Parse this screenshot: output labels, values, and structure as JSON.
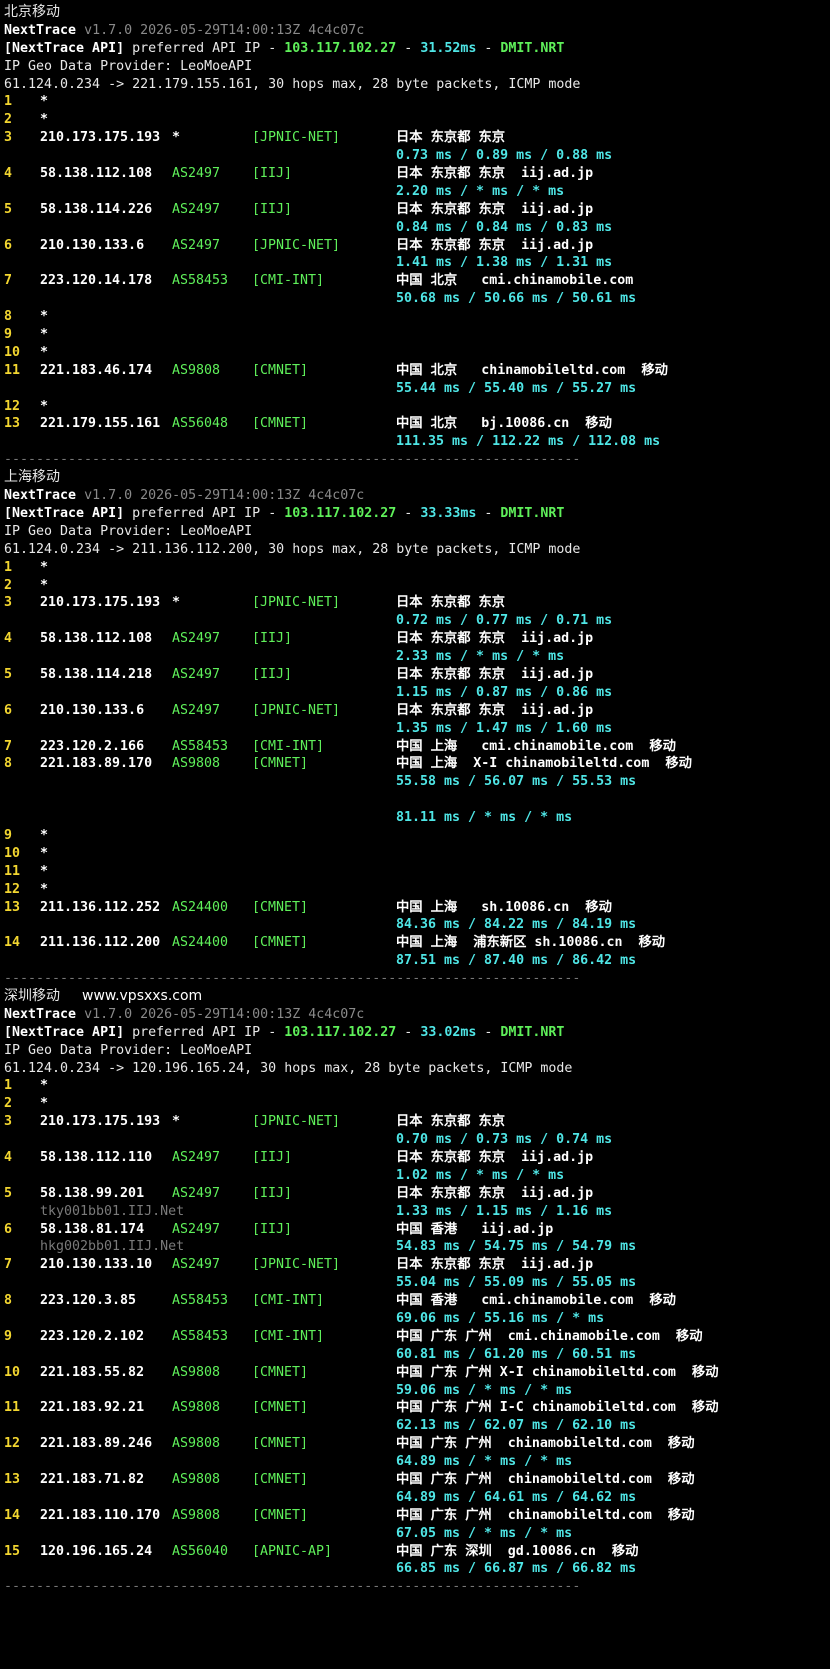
{
  "colors": {
    "background": "#000000",
    "hop_number": "#f3d630",
    "asn_tag": "#5ff05a",
    "latency": "#4fe6e6",
    "version_meta": "#8a8a8a"
  },
  "watermark": "www.vpsxxs.com",
  "traces": [
    {
      "title": "北京移动",
      "app_name": "NextTrace",
      "version": "v1.7.0 2026-05-29T14:00:13Z 4c4c07c",
      "api_prefix": "[NextTrace API]",
      "api_mid": "preferred API IP",
      "api_ip": "103.117.102.27",
      "api_latency": "31.52ms",
      "api_node": "DMIT.NRT",
      "geo_provider": "IP Geo Data Provider: LeoMoeAPI",
      "target_line": "61.124.0.234 -> 221.179.155.161, 30 hops max, 28 byte packets, ICMP mode",
      "hops": [
        {
          "n": "1",
          "ip": "*"
        },
        {
          "n": "2",
          "ip": "*"
        },
        {
          "n": "3",
          "ip": "210.173.175.193",
          "as": "*",
          "tag": "[JPNIC-NET]",
          "geo": "日本 东京都 东京",
          "rtt": "0.73 ms / 0.89 ms / 0.88 ms"
        },
        {
          "n": "4",
          "ip": "58.138.112.108",
          "as": "AS2497",
          "tag": "[IIJ]",
          "geo": "日本 东京都 东京  iij.ad.jp",
          "rtt": "2.20 ms / * ms / * ms"
        },
        {
          "n": "5",
          "ip": "58.138.114.226",
          "as": "AS2497",
          "tag": "[IIJ]",
          "geo": "日本 东京都 东京  iij.ad.jp",
          "rtt": "0.84 ms / 0.84 ms / 0.83 ms"
        },
        {
          "n": "6",
          "ip": "210.130.133.6",
          "as": "AS2497",
          "tag": "[JPNIC-NET]",
          "geo": "日本 东京都 东京  iij.ad.jp",
          "rtt": "1.41 ms / 1.38 ms / 1.31 ms"
        },
        {
          "n": "7",
          "ip": "223.120.14.178",
          "as": "AS58453",
          "tag": "[CMI-INT]",
          "geo": "中国 北京   cmi.chinamobile.com",
          "rtt": "50.68 ms / 50.66 ms / 50.61 ms"
        },
        {
          "n": "8",
          "ip": "*"
        },
        {
          "n": "9",
          "ip": "*"
        },
        {
          "n": "10",
          "ip": "*"
        },
        {
          "n": "11",
          "ip": "221.183.46.174",
          "as": "AS9808",
          "tag": "[CMNET]",
          "geo": "中国 北京   chinamobileltd.com  移动",
          "rtt": "55.44 ms / 55.40 ms / 55.27 ms"
        },
        {
          "n": "12",
          "ip": "*"
        },
        {
          "n": "13",
          "ip": "221.179.155.161",
          "as": "AS56048",
          "tag": "[CMNET]",
          "geo": "中国 北京   bj.10086.cn  移动",
          "rtt": "111.35 ms / 112.22 ms / 112.08 ms"
        }
      ]
    },
    {
      "title": "上海移动",
      "app_name": "NextTrace",
      "version": "v1.7.0 2026-05-29T14:00:13Z 4c4c07c",
      "api_prefix": "[NextTrace API]",
      "api_mid": "preferred API IP",
      "api_ip": "103.117.102.27",
      "api_latency": "33.33ms",
      "api_node": "DMIT.NRT",
      "geo_provider": "IP Geo Data Provider: LeoMoeAPI",
      "target_line": "61.124.0.234 -> 211.136.112.200, 30 hops max, 28 byte packets, ICMP mode",
      "hops": [
        {
          "n": "1",
          "ip": "*"
        },
        {
          "n": "2",
          "ip": "*"
        },
        {
          "n": "3",
          "ip": "210.173.175.193",
          "as": "*",
          "tag": "[JPNIC-NET]",
          "geo": "日本 东京都 东京",
          "rtt": "0.72 ms / 0.77 ms / 0.71 ms"
        },
        {
          "n": "4",
          "ip": "58.138.112.108",
          "as": "AS2497",
          "tag": "[IIJ]",
          "geo": "日本 东京都 东京  iij.ad.jp",
          "rtt": "2.33 ms / * ms / * ms"
        },
        {
          "n": "5",
          "ip": "58.138.114.218",
          "as": "AS2497",
          "tag": "[IIJ]",
          "geo": "日本 东京都 东京  iij.ad.jp",
          "rtt": "1.15 ms / 0.87 ms / 0.86 ms"
        },
        {
          "n": "6",
          "ip": "210.130.133.6",
          "as": "AS2497",
          "tag": "[JPNIC-NET]",
          "geo": "日本 东京都 东京  iij.ad.jp",
          "rtt": "1.35 ms / 1.47 ms / 1.60 ms"
        },
        {
          "n": "7",
          "ip": "223.120.2.166",
          "as": "AS58453",
          "tag": "[CMI-INT]",
          "geo": "中国 上海   cmi.chinamobile.com  移动"
        },
        {
          "n": "8",
          "ip": "221.183.89.170",
          "as": "AS9808",
          "tag": "[CMNET]",
          "geo": "中国 上海  X-I chinamobileltd.com  移动",
          "rtt": "55.58 ms / 56.07 ms / 55.53 ms"
        },
        {
          "n": "",
          "ip": "",
          "rtt": "81.11 ms / * ms / * ms"
        },
        {
          "n": "9",
          "ip": "*"
        },
        {
          "n": "10",
          "ip": "*"
        },
        {
          "n": "11",
          "ip": "*"
        },
        {
          "n": "12",
          "ip": "*"
        },
        {
          "n": "13",
          "ip": "211.136.112.252",
          "as": "AS24400",
          "tag": "[CMNET]",
          "geo": "中国 上海   sh.10086.cn  移动",
          "rtt": "84.36 ms / 84.22 ms / 84.19 ms"
        },
        {
          "n": "14",
          "ip": "211.136.112.200",
          "as": "AS24400",
          "tag": "[CMNET]",
          "geo": "中国 上海  浦东新区 sh.10086.cn  移动",
          "rtt": "87.51 ms / 87.40 ms / 86.42 ms"
        }
      ]
    },
    {
      "title": "深圳移动",
      "app_name": "NextTrace",
      "version": "v1.7.0 2026-05-29T14:00:13Z 4c4c07c",
      "api_prefix": "[NextTrace API]",
      "api_mid": "preferred API IP",
      "api_ip": "103.117.102.27",
      "api_latency": "33.02ms",
      "api_node": "DMIT.NRT",
      "geo_provider": "IP Geo Data Provider: LeoMoeAPI",
      "target_line": "61.124.0.234 -> 120.196.165.24, 30 hops max, 28 byte packets, ICMP mode",
      "hops": [
        {
          "n": "1",
          "ip": "*"
        },
        {
          "n": "2",
          "ip": "*"
        },
        {
          "n": "3",
          "ip": "210.173.175.193",
          "as": "*",
          "tag": "[JPNIC-NET]",
          "geo": "日本 东京都 东京",
          "rtt": "0.70 ms / 0.73 ms / 0.74 ms"
        },
        {
          "n": "4",
          "ip": "58.138.112.110",
          "as": "AS2497",
          "tag": "[IIJ]",
          "geo": "日本 东京都 东京  iij.ad.jp",
          "rtt": "1.02 ms / * ms / * ms"
        },
        {
          "n": "5",
          "ip": "58.138.99.201",
          "as": "AS2497",
          "tag": "[IIJ]",
          "geo": "日本 东京都 东京  iij.ad.jp",
          "host": "tky001bb01.IIJ.Net",
          "rtt": "1.33 ms / 1.15 ms / 1.16 ms"
        },
        {
          "n": "6",
          "ip": "58.138.81.174",
          "as": "AS2497",
          "tag": "[IIJ]",
          "geo": "中国 香港   iij.ad.jp",
          "host": "hkg002bb01.IIJ.Net",
          "rtt": "54.83 ms / 54.75 ms / 54.79 ms"
        },
        {
          "n": "7",
          "ip": "210.130.133.10",
          "as": "AS2497",
          "tag": "[JPNIC-NET]",
          "geo": "日本 东京都 东京  iij.ad.jp",
          "rtt": "55.04 ms / 55.09 ms / 55.05 ms"
        },
        {
          "n": "8",
          "ip": "223.120.3.85",
          "as": "AS58453",
          "tag": "[CMI-INT]",
          "geo": "中国 香港   cmi.chinamobile.com  移动",
          "rtt": "69.06 ms / 55.16 ms / * ms"
        },
        {
          "n": "9",
          "ip": "223.120.2.102",
          "as": "AS58453",
          "tag": "[CMI-INT]",
          "geo": "中国 广东 广州  cmi.chinamobile.com  移动",
          "rtt": "60.81 ms / 61.20 ms / 60.51 ms"
        },
        {
          "n": "10",
          "ip": "221.183.55.82",
          "as": "AS9808",
          "tag": "[CMNET]",
          "geo": "中国 广东 广州 X-I chinamobileltd.com  移动",
          "rtt": "59.06 ms / * ms / * ms"
        },
        {
          "n": "11",
          "ip": "221.183.92.21",
          "as": "AS9808",
          "tag": "[CMNET]",
          "geo": "中国 广东 广州 I-C chinamobileltd.com  移动",
          "rtt": "62.13 ms / 62.07 ms / 62.10 ms"
        },
        {
          "n": "12",
          "ip": "221.183.89.246",
          "as": "AS9808",
          "tag": "[CMNET]",
          "geo": "中国 广东 广州  chinamobileltd.com  移动",
          "rtt": "64.89 ms / * ms / * ms"
        },
        {
          "n": "13",
          "ip": "221.183.71.82",
          "as": "AS9808",
          "tag": "[CMNET]",
          "geo": "中国 广东 广州  chinamobileltd.com  移动",
          "rtt": "64.89 ms / 64.61 ms / 64.62 ms"
        },
        {
          "n": "14",
          "ip": "221.183.110.170",
          "as": "AS9808",
          "tag": "[CMNET]",
          "geo": "中国 广东 广州  chinamobileltd.com  移动",
          "rtt": "67.05 ms / * ms / * ms"
        },
        {
          "n": "15",
          "ip": "120.196.165.24",
          "as": "AS56040",
          "tag": "[APNIC-AP]",
          "geo": "中国 广东 深圳  gd.10086.cn  移动",
          "rtt": "66.85 ms / 66.87 ms / 66.82 ms"
        }
      ]
    }
  ],
  "separator": "------------------------------------------------------------------------"
}
